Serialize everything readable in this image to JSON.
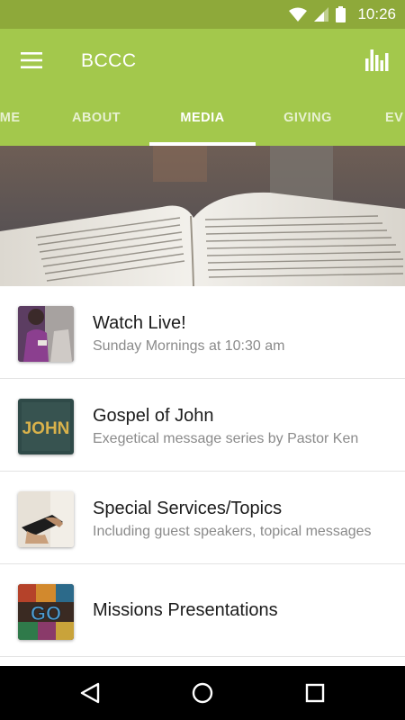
{
  "status_bar": {
    "time": "10:26"
  },
  "app_bar": {
    "title": "BCCC",
    "menu_icon": "hamburger-menu-icon",
    "stats_icon": "bar-chart-icon",
    "background_color": "#a3c84c"
  },
  "tabs": [
    {
      "label": "OME",
      "active": false
    },
    {
      "label": "ABOUT",
      "active": false
    },
    {
      "label": "MEDIA",
      "active": true
    },
    {
      "label": "GIVING",
      "active": false
    },
    {
      "label": "EV",
      "active": false
    }
  ],
  "media_items": [
    {
      "title": "Watch Live!",
      "subtitle": "Sunday Mornings at 10:30 am"
    },
    {
      "title": "Gospel of John",
      "subtitle": "Exegetical message series by Pastor Ken",
      "thumb_text": "JOHN"
    },
    {
      "title": "Special Services/Topics",
      "subtitle": "Including guest speakers, topical messages"
    },
    {
      "title": "Missions Presentations",
      "thumb_text": "GO"
    }
  ]
}
